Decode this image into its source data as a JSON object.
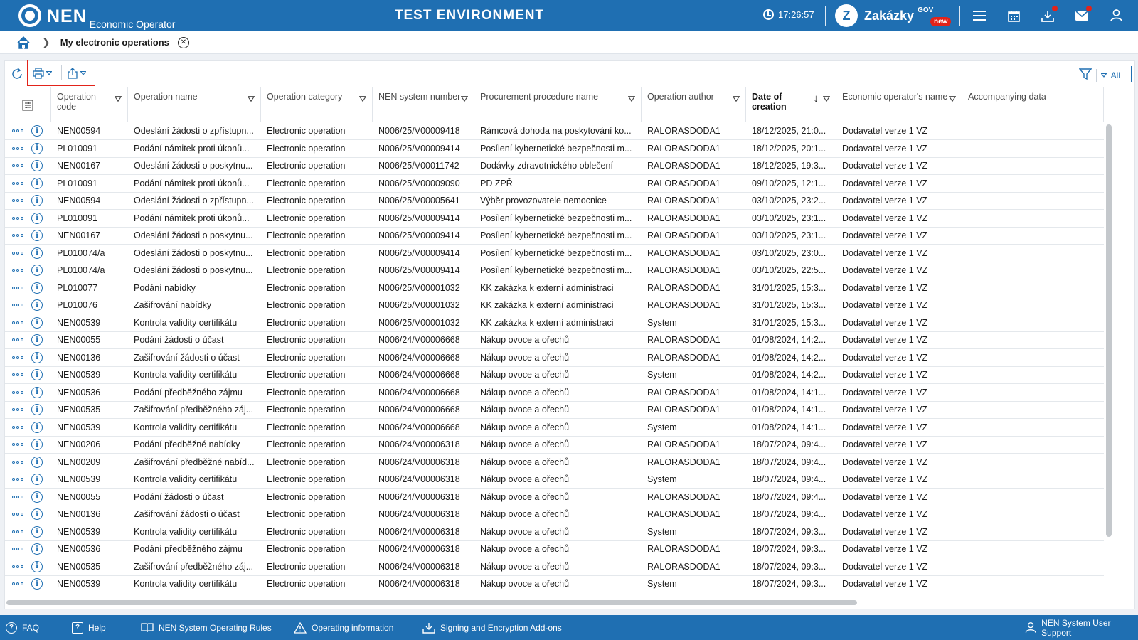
{
  "header": {
    "logo_text": "NEN",
    "logo_sub": "Economic Operator",
    "env_title": "TEST ENVIRONMENT",
    "time": "17:26:57",
    "zakazky_label": "Zakázky",
    "zakazky_gov": "GOV",
    "zakazky_badge": "new"
  },
  "breadcrumb": {
    "title": "My electronic operations"
  },
  "toolbar": {
    "filter_all": "All"
  },
  "columns": [
    {
      "key": "code",
      "label": "Operation code"
    },
    {
      "key": "name",
      "label": "Operation name"
    },
    {
      "key": "category",
      "label": "Operation category"
    },
    {
      "key": "nen",
      "label": "NEN system number"
    },
    {
      "key": "procurement",
      "label": "Procurement procedure name"
    },
    {
      "key": "author",
      "label": "Operation author"
    },
    {
      "key": "date",
      "label": "Date of creation"
    },
    {
      "key": "operator",
      "label": "Economic operator's name"
    },
    {
      "key": "accompanying",
      "label": "Accompanying data"
    }
  ],
  "rows": [
    {
      "code": "NEN00594",
      "name": "Odeslání žádosti o zpřístupn...",
      "category": "Electronic operation",
      "nen": "N006/25/V00009418",
      "procurement": "Rámcová dohoda na poskytování ko...",
      "author": "RALORASDODA1",
      "date": "18/12/2025, 21:0...",
      "operator": "Dodavatel verze 1 VZ",
      "accompanying": ""
    },
    {
      "code": "PL010091",
      "name": "Podání námitek proti úkonů...",
      "category": "Electronic operation",
      "nen": "N006/25/V00009414",
      "procurement": "Posílení kybernetické bezpečnosti m...",
      "author": "RALORASDODA1",
      "date": "18/12/2025, 20:1...",
      "operator": "Dodavatel verze 1 VZ",
      "accompanying": ""
    },
    {
      "code": "NEN00167",
      "name": "Odeslání žádosti o poskytnu...",
      "category": "Electronic operation",
      "nen": "N006/25/V00011742",
      "procurement": "Dodávky zdravotnického oblečení",
      "author": "RALORASDODA1",
      "date": "18/12/2025, 19:3...",
      "operator": "Dodavatel verze 1 VZ",
      "accompanying": ""
    },
    {
      "code": "PL010091",
      "name": "Podání námitek proti úkonů...",
      "category": "Electronic operation",
      "nen": "N006/25/V00009090",
      "procurement": "PD ZPŘ",
      "author": "RALORASDODA1",
      "date": "09/10/2025, 12:1...",
      "operator": "Dodavatel verze 1 VZ",
      "accompanying": ""
    },
    {
      "code": "NEN00594",
      "name": "Odeslání žádosti o zpřístupn...",
      "category": "Electronic operation",
      "nen": "N006/25/V00005641",
      "procurement": "Výběr provozovatele nemocnice",
      "author": "RALORASDODA1",
      "date": "03/10/2025, 23:2...",
      "operator": "Dodavatel verze 1 VZ",
      "accompanying": ""
    },
    {
      "code": "PL010091",
      "name": "Podání námitek proti úkonů...",
      "category": "Electronic operation",
      "nen": "N006/25/V00009414",
      "procurement": "Posílení kybernetické bezpečnosti m...",
      "author": "RALORASDODA1",
      "date": "03/10/2025, 23:1...",
      "operator": "Dodavatel verze 1 VZ",
      "accompanying": ""
    },
    {
      "code": "NEN00167",
      "name": "Odeslání žádosti o poskytnu...",
      "category": "Electronic operation",
      "nen": "N006/25/V00009414",
      "procurement": "Posílení kybernetické bezpečnosti m...",
      "author": "RALORASDODA1",
      "date": "03/10/2025, 23:1...",
      "operator": "Dodavatel verze 1 VZ",
      "accompanying": ""
    },
    {
      "code": "PL010074/a",
      "name": "Odeslání žádosti o poskytnu...",
      "category": "Electronic operation",
      "nen": "N006/25/V00009414",
      "procurement": "Posílení kybernetické bezpečnosti m...",
      "author": "RALORASDODA1",
      "date": "03/10/2025, 23:0...",
      "operator": "Dodavatel verze 1 VZ",
      "accompanying": ""
    },
    {
      "code": "PL010074/a",
      "name": "Odeslání žádosti o poskytnu...",
      "category": "Electronic operation",
      "nen": "N006/25/V00009414",
      "procurement": "Posílení kybernetické bezpečnosti m...",
      "author": "RALORASDODA1",
      "date": "03/10/2025, 22:5...",
      "operator": "Dodavatel verze 1 VZ",
      "accompanying": ""
    },
    {
      "code": "PL010077",
      "name": "Podání nabídky",
      "category": "Electronic operation",
      "nen": "N006/25/V00001032",
      "procurement": "KK zakázka k externí administraci",
      "author": "RALORASDODA1",
      "date": "31/01/2025, 15:3...",
      "operator": "Dodavatel verze 1 VZ",
      "accompanying": ""
    },
    {
      "code": "PL010076",
      "name": "Zašifrování nabídky",
      "category": "Electronic operation",
      "nen": "N006/25/V00001032",
      "procurement": "KK zakázka k externí administraci",
      "author": "RALORASDODA1",
      "date": "31/01/2025, 15:3...",
      "operator": "Dodavatel verze 1 VZ",
      "accompanying": ""
    },
    {
      "code": "NEN00539",
      "name": "Kontrola validity certifikátu",
      "category": "Electronic operation",
      "nen": "N006/25/V00001032",
      "procurement": "KK zakázka k externí administraci",
      "author": "System",
      "date": "31/01/2025, 15:3...",
      "operator": "Dodavatel verze 1 VZ",
      "accompanying": ""
    },
    {
      "code": "NEN00055",
      "name": "Podání žádosti o účast",
      "category": "Electronic operation",
      "nen": "N006/24/V00006668",
      "procurement": "Nákup ovoce a ořechů",
      "author": "RALORASDODA1",
      "date": "01/08/2024, 14:2...",
      "operator": "Dodavatel verze 1 VZ",
      "accompanying": ""
    },
    {
      "code": "NEN00136",
      "name": "Zašifrování žádosti o účast",
      "category": "Electronic operation",
      "nen": "N006/24/V00006668",
      "procurement": "Nákup ovoce a ořechů",
      "author": "RALORASDODA1",
      "date": "01/08/2024, 14:2...",
      "operator": "Dodavatel verze 1 VZ",
      "accompanying": ""
    },
    {
      "code": "NEN00539",
      "name": "Kontrola validity certifikátu",
      "category": "Electronic operation",
      "nen": "N006/24/V00006668",
      "procurement": "Nákup ovoce a ořechů",
      "author": "System",
      "date": "01/08/2024, 14:2...",
      "operator": "Dodavatel verze 1 VZ",
      "accompanying": ""
    },
    {
      "code": "NEN00536",
      "name": "Podání předběžného zájmu",
      "category": "Electronic operation",
      "nen": "N006/24/V00006668",
      "procurement": "Nákup ovoce a ořechů",
      "author": "RALORASDODA1",
      "date": "01/08/2024, 14:1...",
      "operator": "Dodavatel verze 1 VZ",
      "accompanying": ""
    },
    {
      "code": "NEN00535",
      "name": "Zašifrování předběžného záj...",
      "category": "Electronic operation",
      "nen": "N006/24/V00006668",
      "procurement": "Nákup ovoce a ořechů",
      "author": "RALORASDODA1",
      "date": "01/08/2024, 14:1...",
      "operator": "Dodavatel verze 1 VZ",
      "accompanying": ""
    },
    {
      "code": "NEN00539",
      "name": "Kontrola validity certifikátu",
      "category": "Electronic operation",
      "nen": "N006/24/V00006668",
      "procurement": "Nákup ovoce a ořechů",
      "author": "System",
      "date": "01/08/2024, 14:1...",
      "operator": "Dodavatel verze 1 VZ",
      "accompanying": ""
    },
    {
      "code": "NEN00206",
      "name": "Podání předběžné nabídky",
      "category": "Electronic operation",
      "nen": "N006/24/V00006318",
      "procurement": "Nákup ovoce a ořechů",
      "author": "RALORASDODA1",
      "date": "18/07/2024, 09:4...",
      "operator": "Dodavatel verze 1 VZ",
      "accompanying": ""
    },
    {
      "code": "NEN00209",
      "name": "Zašifrování předběžné nabíd...",
      "category": "Electronic operation",
      "nen": "N006/24/V00006318",
      "procurement": "Nákup ovoce a ořechů",
      "author": "RALORASDODA1",
      "date": "18/07/2024, 09:4...",
      "operator": "Dodavatel verze 1 VZ",
      "accompanying": ""
    },
    {
      "code": "NEN00539",
      "name": "Kontrola validity certifikátu",
      "category": "Electronic operation",
      "nen": "N006/24/V00006318",
      "procurement": "Nákup ovoce a ořechů",
      "author": "System",
      "date": "18/07/2024, 09:4...",
      "operator": "Dodavatel verze 1 VZ",
      "accompanying": ""
    },
    {
      "code": "NEN00055",
      "name": "Podání žádosti o účast",
      "category": "Electronic operation",
      "nen": "N006/24/V00006318",
      "procurement": "Nákup ovoce a ořechů",
      "author": "RALORASDODA1",
      "date": "18/07/2024, 09:4...",
      "operator": "Dodavatel verze 1 VZ",
      "accompanying": ""
    },
    {
      "code": "NEN00136",
      "name": "Zašifrování žádosti o účast",
      "category": "Electronic operation",
      "nen": "N006/24/V00006318",
      "procurement": "Nákup ovoce a ořechů",
      "author": "RALORASDODA1",
      "date": "18/07/2024, 09:4...",
      "operator": "Dodavatel verze 1 VZ",
      "accompanying": ""
    },
    {
      "code": "NEN00539",
      "name": "Kontrola validity certifikátu",
      "category": "Electronic operation",
      "nen": "N006/24/V00006318",
      "procurement": "Nákup ovoce a ořechů",
      "author": "System",
      "date": "18/07/2024, 09:3...",
      "operator": "Dodavatel verze 1 VZ",
      "accompanying": ""
    },
    {
      "code": "NEN00536",
      "name": "Podání předběžného zájmu",
      "category": "Electronic operation",
      "nen": "N006/24/V00006318",
      "procurement": "Nákup ovoce a ořechů",
      "author": "RALORASDODA1",
      "date": "18/07/2024, 09:3...",
      "operator": "Dodavatel verze 1 VZ",
      "accompanying": ""
    },
    {
      "code": "NEN00535",
      "name": "Zašifrování předběžného záj...",
      "category": "Electronic operation",
      "nen": "N006/24/V00006318",
      "procurement": "Nákup ovoce a ořechů",
      "author": "RALORASDODA1",
      "date": "18/07/2024, 09:3...",
      "operator": "Dodavatel verze 1 VZ",
      "accompanying": ""
    },
    {
      "code": "NEN00539",
      "name": "Kontrola validity certifikátu",
      "category": "Electronic operation",
      "nen": "N006/24/V00006318",
      "procurement": "Nákup ovoce a ořechů",
      "author": "System",
      "date": "18/07/2024, 09:3...",
      "operator": "Dodavatel verze 1 VZ",
      "accompanying": ""
    }
  ],
  "footer": {
    "faq": "FAQ",
    "help": "Help",
    "rules": "NEN System Operating Rules",
    "operating_info": "Operating information",
    "addons": "Signing and Encryption Add-ons",
    "support": "NEN System User Support"
  },
  "colors": {
    "brand_blue": "#1f6fb2",
    "highlight_red": "#e2231a"
  }
}
